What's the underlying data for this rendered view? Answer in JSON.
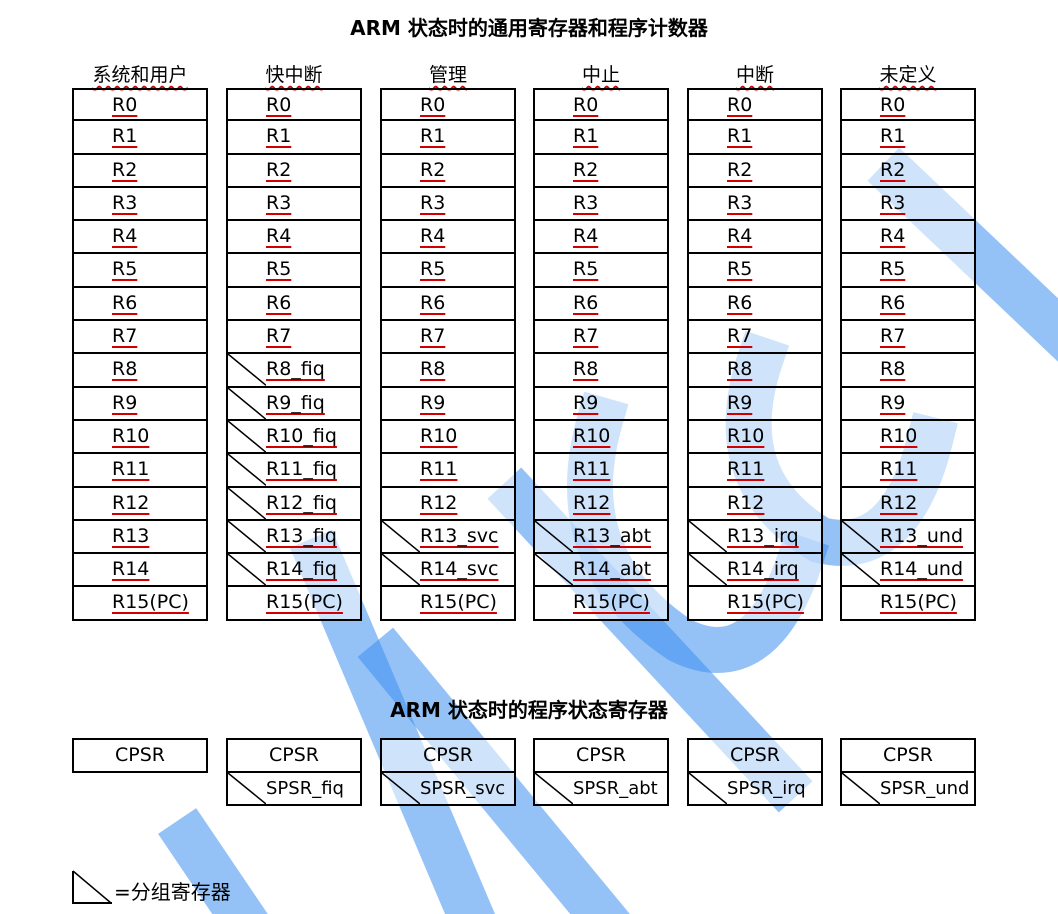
{
  "title_general": "ARM 状态时的通用寄存器和程序计数器",
  "title_status": "ARM 状态时的程序状态寄存器",
  "banks": [
    {
      "mode": "系统和用户",
      "registers": [
        {
          "name": "R0",
          "banked": false
        },
        {
          "name": "R1",
          "banked": false
        },
        {
          "name": "R2",
          "banked": false
        },
        {
          "name": "R3",
          "banked": false
        },
        {
          "name": "R4",
          "banked": false
        },
        {
          "name": "R5",
          "banked": false
        },
        {
          "name": "R6",
          "banked": false
        },
        {
          "name": "R7",
          "banked": false
        },
        {
          "name": "R8",
          "banked": false
        },
        {
          "name": "R9",
          "banked": false
        },
        {
          "name": "R10",
          "banked": false
        },
        {
          "name": "R11",
          "banked": false
        },
        {
          "name": "R12",
          "banked": false
        },
        {
          "name": "R13",
          "banked": false
        },
        {
          "name": "R14",
          "banked": false
        },
        {
          "name": "R15(PC)",
          "banked": false
        }
      ]
    },
    {
      "mode": "快中断",
      "registers": [
        {
          "name": "R0",
          "banked": false
        },
        {
          "name": "R1",
          "banked": false
        },
        {
          "name": "R2",
          "banked": false
        },
        {
          "name": "R3",
          "banked": false
        },
        {
          "name": "R4",
          "banked": false
        },
        {
          "name": "R5",
          "banked": false
        },
        {
          "name": "R6",
          "banked": false
        },
        {
          "name": "R7",
          "banked": false
        },
        {
          "name": "R8_fiq",
          "banked": true
        },
        {
          "name": "R9_fiq",
          "banked": true
        },
        {
          "name": "R10_fiq",
          "banked": true
        },
        {
          "name": "R11_fiq",
          "banked": true
        },
        {
          "name": "R12_fiq",
          "banked": true
        },
        {
          "name": "R13_fiq",
          "banked": true
        },
        {
          "name": "R14_fiq",
          "banked": true
        },
        {
          "name": "R15(PC)",
          "banked": false
        }
      ]
    },
    {
      "mode": "管理",
      "registers": [
        {
          "name": "R0",
          "banked": false
        },
        {
          "name": "R1",
          "banked": false
        },
        {
          "name": "R2",
          "banked": false
        },
        {
          "name": "R3",
          "banked": false
        },
        {
          "name": "R4",
          "banked": false
        },
        {
          "name": "R5",
          "banked": false
        },
        {
          "name": "R6",
          "banked": false
        },
        {
          "name": "R7",
          "banked": false
        },
        {
          "name": "R8",
          "banked": false
        },
        {
          "name": "R9",
          "banked": false
        },
        {
          "name": "R10",
          "banked": false
        },
        {
          "name": "R11",
          "banked": false
        },
        {
          "name": "R12",
          "banked": false
        },
        {
          "name": "R13_svc",
          "banked": true
        },
        {
          "name": "R14_svc",
          "banked": true
        },
        {
          "name": "R15(PC)",
          "banked": false
        }
      ]
    },
    {
      "mode": "中止",
      "registers": [
        {
          "name": "R0",
          "banked": false
        },
        {
          "name": "R1",
          "banked": false
        },
        {
          "name": "R2",
          "banked": false
        },
        {
          "name": "R3",
          "banked": false
        },
        {
          "name": "R4",
          "banked": false
        },
        {
          "name": "R5",
          "banked": false
        },
        {
          "name": "R6",
          "banked": false
        },
        {
          "name": "R7",
          "banked": false
        },
        {
          "name": "R8",
          "banked": false
        },
        {
          "name": "R9",
          "banked": false
        },
        {
          "name": "R10",
          "banked": false
        },
        {
          "name": "R11",
          "banked": false
        },
        {
          "name": "R12",
          "banked": false
        },
        {
          "name": "R13_abt",
          "banked": true
        },
        {
          "name": "R14_abt",
          "banked": true
        },
        {
          "name": "R15(PC)",
          "banked": false
        }
      ]
    },
    {
      "mode": "中断",
      "registers": [
        {
          "name": "R0",
          "banked": false
        },
        {
          "name": "R1",
          "banked": false
        },
        {
          "name": "R2",
          "banked": false
        },
        {
          "name": "R3",
          "banked": false
        },
        {
          "name": "R4",
          "banked": false
        },
        {
          "name": "R5",
          "banked": false
        },
        {
          "name": "R6",
          "banked": false
        },
        {
          "name": "R7",
          "banked": false
        },
        {
          "name": "R8",
          "banked": false
        },
        {
          "name": "R9",
          "banked": false
        },
        {
          "name": "R10",
          "banked": false
        },
        {
          "name": "R11",
          "banked": false
        },
        {
          "name": "R12",
          "banked": false
        },
        {
          "name": "R13_irq",
          "banked": true
        },
        {
          "name": "R14_irq",
          "banked": true
        },
        {
          "name": "R15(PC)",
          "banked": false
        }
      ]
    },
    {
      "mode": "未定义",
      "registers": [
        {
          "name": "R0",
          "banked": false
        },
        {
          "name": "R1",
          "banked": false
        },
        {
          "name": "R2",
          "banked": false
        },
        {
          "name": "R3",
          "banked": false
        },
        {
          "name": "R4",
          "banked": false
        },
        {
          "name": "R5",
          "banked": false
        },
        {
          "name": "R6",
          "banked": false
        },
        {
          "name": "R7",
          "banked": false
        },
        {
          "name": "R8",
          "banked": false
        },
        {
          "name": "R9",
          "banked": false
        },
        {
          "name": "R10",
          "banked": false
        },
        {
          "name": "R11",
          "banked": false
        },
        {
          "name": "R12",
          "banked": false
        },
        {
          "name": "R13_und",
          "banked": true
        },
        {
          "name": "R14_und",
          "banked": true
        },
        {
          "name": "R15(PC)",
          "banked": false
        }
      ]
    }
  ],
  "status": [
    {
      "cpsr": "CPSR",
      "spsr": ""
    },
    {
      "cpsr": "CPSR",
      "spsr": "SPSR_fiq"
    },
    {
      "cpsr": "CPSR",
      "spsr": "SPSR_svc"
    },
    {
      "cpsr": "CPSR",
      "spsr": "SPSR_abt"
    },
    {
      "cpsr": "CPSR",
      "spsr": "SPSR_irq"
    },
    {
      "cpsr": "CPSR",
      "spsr": "SPSR_und"
    }
  ],
  "legend_text": "=分组寄存器",
  "colors": {
    "underline": "#d00000",
    "watermark": "#3d8ff0",
    "border": "#000000"
  }
}
